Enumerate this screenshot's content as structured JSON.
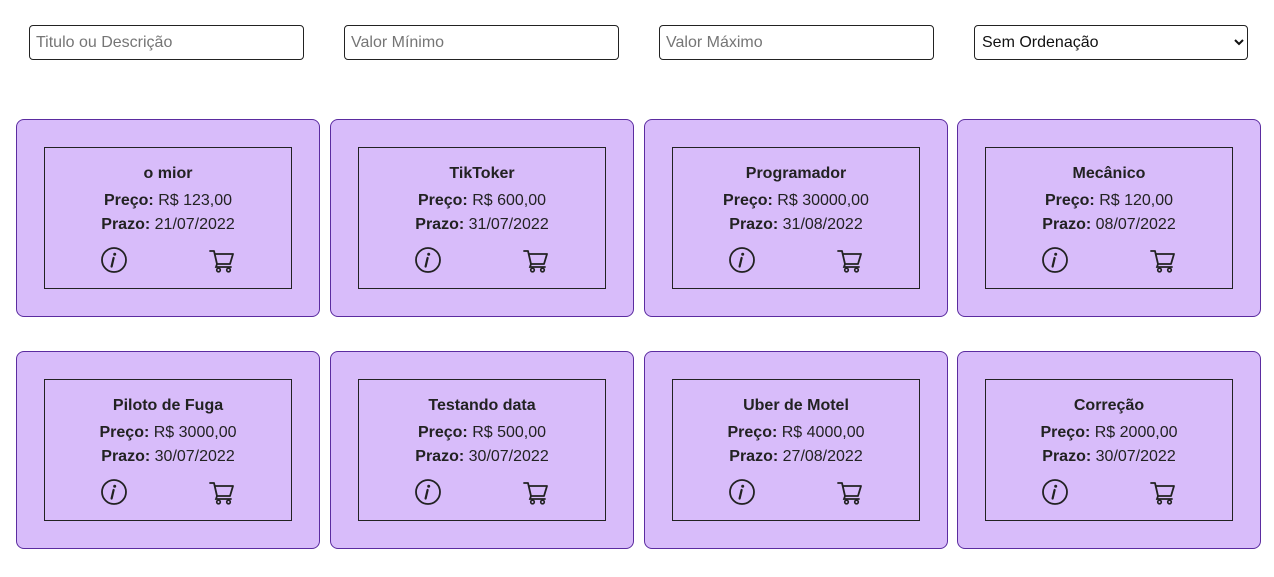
{
  "filters": {
    "search_placeholder": "Titulo ou Descrição",
    "min_placeholder": "Valor Mínimo",
    "max_placeholder": "Valor Máximo",
    "sort_selected": "Sem Ordenação"
  },
  "labels": {
    "price": "Preço:",
    "deadline": "Prazo:"
  },
  "colors": {
    "card_bg": "#d8bcfa",
    "card_border": "#5b2ca0"
  },
  "icons": {
    "info": "info-icon",
    "cart": "cart-icon"
  },
  "cards": [
    {
      "title": "o mior",
      "price": "R$ 123,00",
      "deadline": "21/07/2022"
    },
    {
      "title": "TikToker",
      "price": "R$ 600,00",
      "deadline": "31/07/2022"
    },
    {
      "title": "Programador",
      "price": "R$ 30000,00",
      "deadline": "31/08/2022"
    },
    {
      "title": "Mecânico",
      "price": "R$ 120,00",
      "deadline": "08/07/2022"
    },
    {
      "title": "Piloto de Fuga",
      "price": "R$ 3000,00",
      "deadline": "30/07/2022"
    },
    {
      "title": "Testando data",
      "price": "R$ 500,00",
      "deadline": "30/07/2022"
    },
    {
      "title": "Uber de Motel",
      "price": "R$ 4000,00",
      "deadline": "27/08/2022"
    },
    {
      "title": "Correção",
      "price": "R$ 2000,00",
      "deadline": "30/07/2022"
    }
  ]
}
